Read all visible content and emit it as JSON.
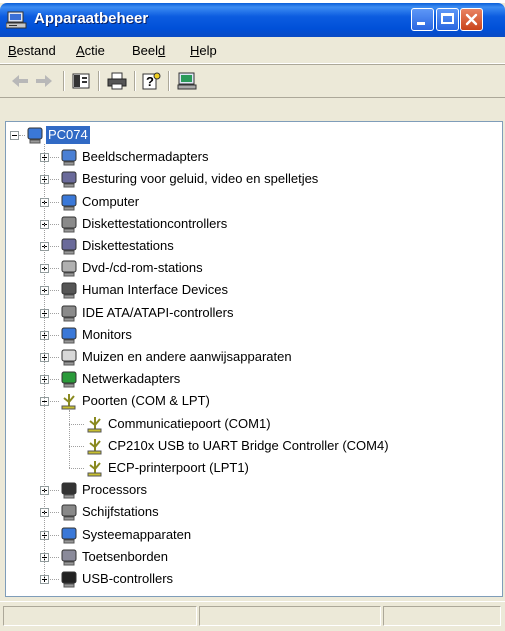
{
  "window": {
    "title": "Apparaatbeheer"
  },
  "menu": [
    {
      "label": "Bestand"
    },
    {
      "label": "Actie"
    },
    {
      "label": "Beeld"
    },
    {
      "label": "Help"
    }
  ],
  "toolbar": [
    "back-arrow-icon",
    "forward-arrow-icon",
    "properties-icon",
    "print-icon",
    "help-icon",
    "scan-hardware-icon"
  ],
  "tree": {
    "root": "PC074",
    "categories": [
      {
        "label": "Beeldschermadapters",
        "icon": "monitor-adapter-icon"
      },
      {
        "label": "Besturing voor geluid, video en spelletjes",
        "icon": "sound-icon"
      },
      {
        "label": "Computer",
        "icon": "computer-icon"
      },
      {
        "label": "Diskettestationcontrollers",
        "icon": "floppy-controller-icon"
      },
      {
        "label": "Diskettestations",
        "icon": "floppy-drive-icon"
      },
      {
        "label": "Dvd-/cd-rom-stations",
        "icon": "cdrom-icon"
      },
      {
        "label": "Human Interface Devices",
        "icon": "hid-icon"
      },
      {
        "label": "IDE ATA/ATAPI-controllers",
        "icon": "ide-icon"
      },
      {
        "label": "Monitors",
        "icon": "monitor-icon"
      },
      {
        "label": "Muizen en andere aanwijsapparaten",
        "icon": "mouse-icon"
      },
      {
        "label": "Netwerkadapters",
        "icon": "network-icon"
      },
      {
        "label": "Poorten (COM & LPT)",
        "icon": "port-icon",
        "expanded": true,
        "children": [
          "Communicatiepoort (COM1)",
          "CP210x USB to UART Bridge Controller (COM4)",
          "ECP-printerpoort (LPT1)"
        ]
      },
      {
        "label": "Processors",
        "icon": "processor-icon"
      },
      {
        "label": "Schijfstations",
        "icon": "disk-icon"
      },
      {
        "label": "Systeemapparaten",
        "icon": "system-icon"
      },
      {
        "label": "Toetsenborden",
        "icon": "keyboard-icon"
      },
      {
        "label": "USB-controllers",
        "icon": "usb-icon"
      }
    ]
  }
}
